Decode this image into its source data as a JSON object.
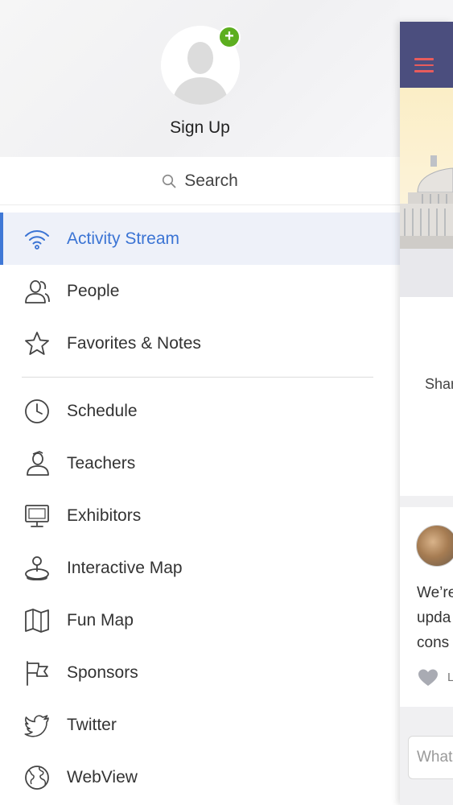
{
  "drawer": {
    "signup_label": "Sign Up",
    "add_badge": "+",
    "search_label": "Search",
    "items_primary": [
      {
        "label": "Activity Stream",
        "icon": "wifi-icon",
        "active": true
      },
      {
        "label": "People",
        "icon": "people-icon",
        "active": false
      },
      {
        "label": "Favorites & Notes",
        "icon": "star-icon",
        "active": false
      }
    ],
    "items_secondary": [
      {
        "label": "Schedule",
        "icon": "clock-icon"
      },
      {
        "label": "Teachers",
        "icon": "teacher-icon"
      },
      {
        "label": "Exhibitors",
        "icon": "monitor-icon"
      },
      {
        "label": "Interactive Map",
        "icon": "map-pin-icon"
      },
      {
        "label": "Fun Map",
        "icon": "folded-map-icon"
      },
      {
        "label": "Sponsors",
        "icon": "flag-icon"
      },
      {
        "label": "Twitter",
        "icon": "twitter-icon"
      },
      {
        "label": "WebView",
        "icon": "globe-icon"
      }
    ]
  },
  "app": {
    "card_share_text": "Shar",
    "post_lines": [
      "We’re",
      "upda",
      "cons"
    ],
    "like_text": "L",
    "composer_placeholder": "What"
  },
  "colors": {
    "accent": "#3b74d4",
    "active_bg": "#eef1f9",
    "badge": "#5cae1f",
    "app_bar": "#4b4e7e",
    "hamburger": "#e85c5c"
  }
}
